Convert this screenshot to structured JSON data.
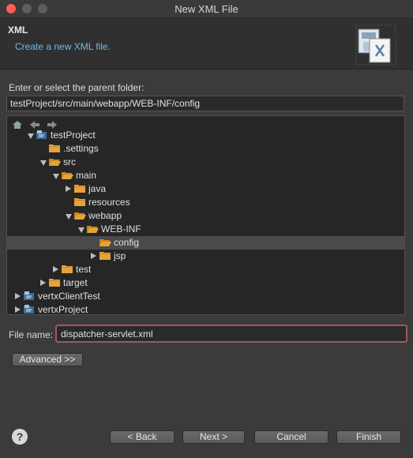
{
  "window": {
    "title": "New XML File"
  },
  "banner": {
    "title": "XML",
    "description": "Create a new XML file."
  },
  "parent_folder": {
    "label": "Enter or select the parent folder:",
    "value": "testProject/src/main/webapp/WEB-INF/config"
  },
  "tree": {
    "items": [
      {
        "label": "testProject",
        "twisty": "expanded",
        "icon": "project"
      },
      {
        "label": ".settings",
        "twisty": "none",
        "icon": "folder"
      },
      {
        "label": "src",
        "twisty": "expanded",
        "icon": "folder-open"
      },
      {
        "label": "main",
        "twisty": "expanded",
        "icon": "folder-open"
      },
      {
        "label": "java",
        "twisty": "collapsed",
        "icon": "folder"
      },
      {
        "label": "resources",
        "twisty": "none",
        "icon": "folder"
      },
      {
        "label": "webapp",
        "twisty": "expanded",
        "icon": "folder-open"
      },
      {
        "label": "WEB-INF",
        "twisty": "expanded",
        "icon": "folder-open"
      },
      {
        "label": "config",
        "twisty": "none",
        "icon": "folder-open",
        "selected": true
      },
      {
        "label": "jsp",
        "twisty": "collapsed",
        "icon": "folder"
      },
      {
        "label": "test",
        "twisty": "collapsed",
        "icon": "folder"
      },
      {
        "label": "target",
        "twisty": "collapsed",
        "icon": "folder"
      },
      {
        "label": "vertxClientTest",
        "twisty": "collapsed",
        "icon": "project"
      },
      {
        "label": "vertxProject",
        "twisty": "collapsed",
        "icon": "project"
      }
    ]
  },
  "file_name": {
    "label": "File name:",
    "value": "dispatcher-servlet.xml"
  },
  "buttons": {
    "advanced": "Advanced >>",
    "back": "< Back",
    "next": "Next >",
    "cancel": "Cancel",
    "finish": "Finish"
  },
  "help": {
    "glyph": "?"
  },
  "colors": {
    "accent": "#74b8e6",
    "folder": "#e6a33a",
    "error_border": "#a1575f"
  },
  "icons": [
    "home-icon",
    "back-arrow-icon",
    "forward-arrow-icon",
    "xml-wizard-icon",
    "help-icon"
  ]
}
